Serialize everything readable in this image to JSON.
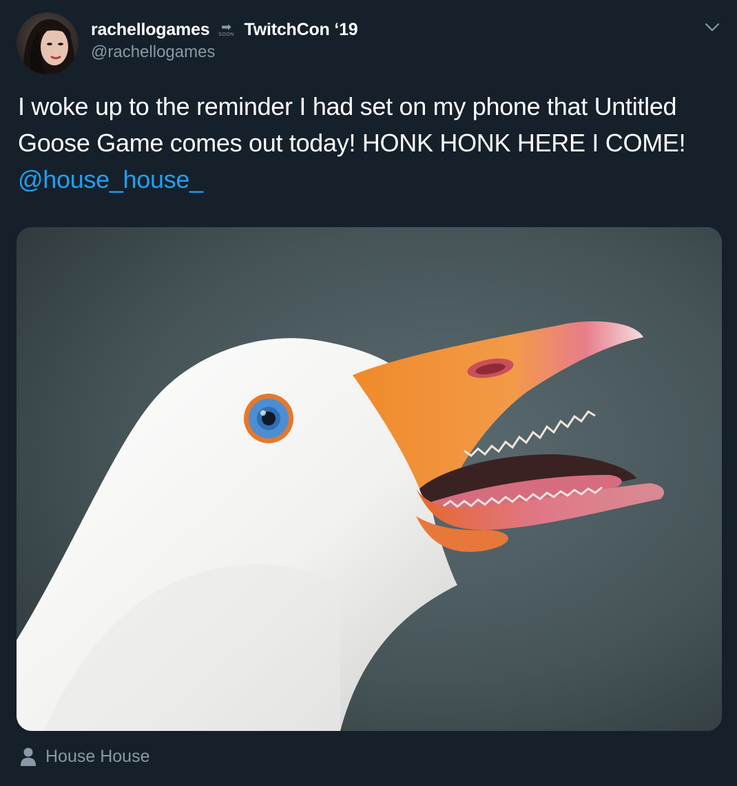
{
  "header": {
    "display_name": "rachellogames",
    "badge_text": "SOON",
    "badge_arrow": "➡",
    "status_name": "TwitchCon ‘19",
    "handle": "@rachellogames",
    "avatar_icon": "profile-photo"
  },
  "tweet": {
    "text_before": "I woke up to the reminder I had set on my phone that Untitled Goose Game comes out today! HONK HONK HERE I COME! ",
    "mention": "@house_house_"
  },
  "media": {
    "alt": "Close-up photo of a white goose honking with its orange beak open"
  },
  "tag": {
    "label": "House House",
    "icon": "person-icon"
  },
  "colors": {
    "background": "#15202b",
    "text": "#ffffff",
    "secondary": "#8b98a5",
    "link": "#1da1f2"
  }
}
